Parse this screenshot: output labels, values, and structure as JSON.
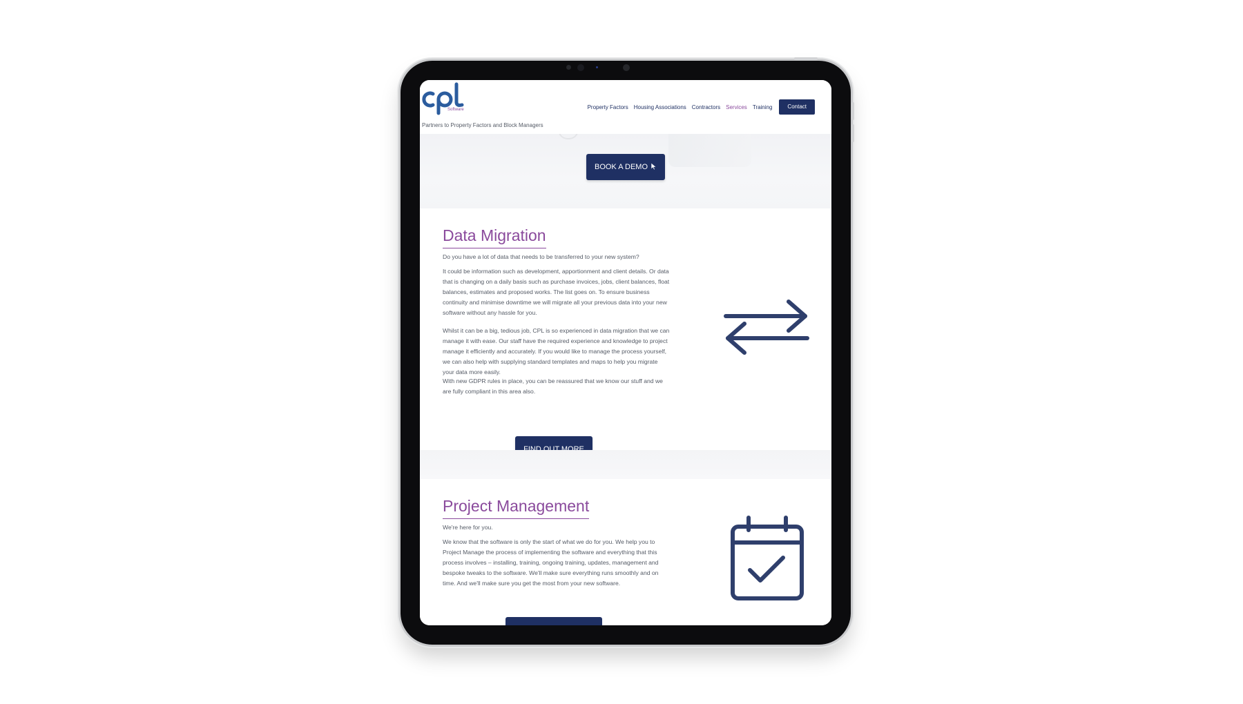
{
  "brand": {
    "logo_text": "cpl",
    "logo_sub": "Software",
    "tagline": "Partners to Property Factors and Block Managers",
    "colors": {
      "navy": "#1f3063",
      "purple": "#8a4a9c",
      "text": "#555b66"
    }
  },
  "nav": {
    "items": [
      {
        "label": "Property Factors",
        "active": false
      },
      {
        "label": "Housing Associations",
        "active": false
      },
      {
        "label": "Contractors",
        "active": false
      },
      {
        "label": "Services",
        "active": true
      },
      {
        "label": "Training",
        "active": false
      }
    ],
    "contact_label": "Contact"
  },
  "hero": {
    "demo_label": "BOOK A DEMO",
    "demo_icon": "cursor-pointer-icon"
  },
  "data_migration": {
    "title": "Data Migration",
    "paragraphs": [
      "Do you have a lot of data that needs to be transferred to your new system?",
      "It could be information such as development, apportionment and client details. Or data that is changing on a daily basis such as purchase invoices, jobs, client balances, float balances, estimates and proposed works. The list goes on. To ensure business continuity and minimise downtime we will migrate all your previous data into your new software without any hassle for you.",
      "Whilst it can be a big, tedious job, CPL is so experienced in data migration that we can manage it with ease. Our staff have the required experience and knowledge to project manage it efficiently and accurately. If you would like to manage the process yourself, we can also help with supplying standard templates and maps to help you migrate your data more easily.",
      "With new GDPR rules in place, you can be reassured that we know our stuff and we are fully compliant in this area also."
    ],
    "button_label": "FIND OUT MORE",
    "icon": "transfer-arrows-icon"
  },
  "project_management": {
    "title": "Project Management",
    "paragraphs": [
      "We're here for you.",
      "We know that the software is only the start of what we do for you. We help you to Project Manage the process of implementing the software and everything that this process involves – installing, training, ongoing training, updates, management and bespoke tweaks to the software. We'll make sure everything runs smoothly and on time. And we'll make sure you get the most from your new software."
    ],
    "icon": "calendar-check-icon"
  }
}
